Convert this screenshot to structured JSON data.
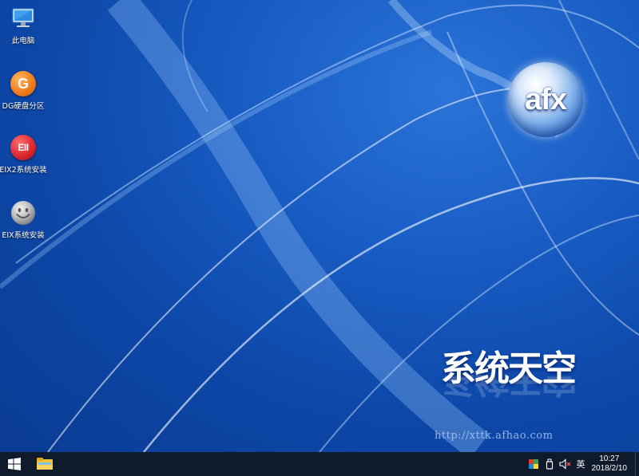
{
  "desktop": {
    "icons": [
      {
        "label": "此电脑",
        "icon": "this-pc-icon"
      },
      {
        "label": "DG硬盘分区",
        "icon": "diskgenius-icon",
        "glyph": "G",
        "color": "#f07a1a"
      },
      {
        "label": "EIX2系统安装",
        "icon": "eix2-installer-icon",
        "glyph": "EII",
        "color": "#d9262c"
      },
      {
        "label": "EIX系统安装",
        "icon": "eix-installer-icon",
        "color": "#b8b8b8"
      }
    ],
    "logo_text": "afx",
    "brand_text": "系统天空",
    "brand_url": "http://xttk.afhao.com"
  },
  "taskbar": {
    "start_icon": "windows-start-icon",
    "pinned": [
      {
        "icon": "file-explorer-icon"
      }
    ],
    "tray": {
      "icons": [
        "color-palette-icon",
        "usb-device-icon",
        "volume-muted-icon"
      ],
      "ime": "英",
      "time": "10:27",
      "date": "2018/2/10"
    }
  },
  "colors": {
    "wallpaper": "#175bc2",
    "taskbar": "#0f1a2b"
  }
}
